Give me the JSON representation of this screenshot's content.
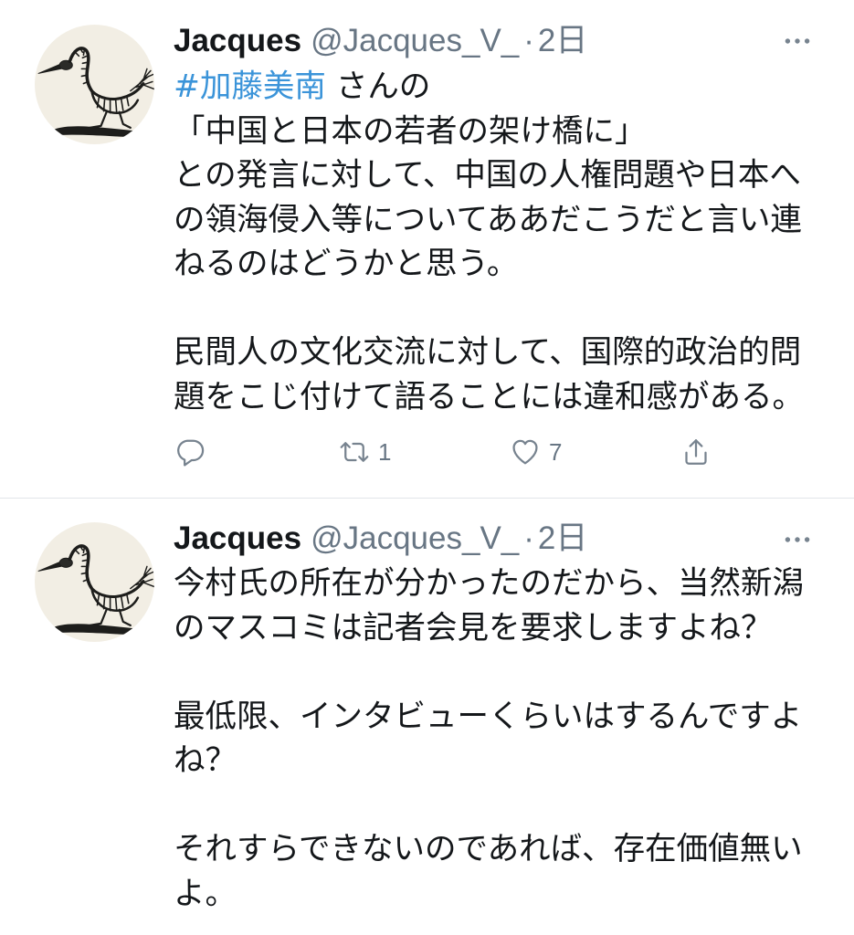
{
  "theme": {
    "text": "#14171a",
    "secondary": "#687684",
    "icon": "#77838f",
    "hashtag": "#3b94d9",
    "divider": "#e1e5e9",
    "avatar_bg": "#f2eee4"
  },
  "timeline": {
    "tweets": [
      {
        "author": {
          "name": "Jacques",
          "handle": "@Jacques_V_",
          "separator": "·",
          "time": "2日",
          "avatar_icon": "bird-sketch-avatar"
        },
        "menu_icon": "more-icon",
        "paragraphs": [
          {
            "lines": [
              {
                "hashtag": "#加藤美南",
                "text": " さんの"
              },
              {
                "text": "「中国と日本の若者の架け橋に」"
              },
              {
                "text": "との発言に対して、中国の人権問題や日本へ"
              },
              {
                "text": "の領海侵入等についてああだこうだと言い連"
              },
              {
                "text": "ねるのはどうかと思う。"
              }
            ]
          },
          {
            "lines": [
              {
                "text": "民間人の文化交流に対して、国際的政治的問"
              },
              {
                "text": "題をこじ付けて語ることには違和感がある。"
              }
            ]
          }
        ],
        "actions": {
          "reply": {
            "icon": "reply-icon"
          },
          "retweet": {
            "icon": "retweet-icon",
            "count": "1"
          },
          "like": {
            "icon": "heart-icon",
            "count": "7"
          },
          "share": {
            "icon": "share-icon"
          }
        }
      },
      {
        "author": {
          "name": "Jacques",
          "handle": "@Jacques_V_",
          "separator": "·",
          "time": "2日",
          "avatar_icon": "bird-sketch-avatar"
        },
        "menu_icon": "more-icon",
        "paragraphs": [
          {
            "lines": [
              {
                "text": "今村氏の所在が分かったのだから、当然新潟"
              },
              {
                "text": "のマスコミは記者会見を要求しますよね？"
              }
            ]
          },
          {
            "lines": [
              {
                "text": "最低限、インタビューくらいはするんですよ"
              },
              {
                "text": "ね？"
              }
            ]
          },
          {
            "lines": [
              {
                "text": "それすらできないのであれば、存在価値無い"
              },
              {
                "text": "よ。"
              }
            ]
          }
        ]
      }
    ]
  }
}
